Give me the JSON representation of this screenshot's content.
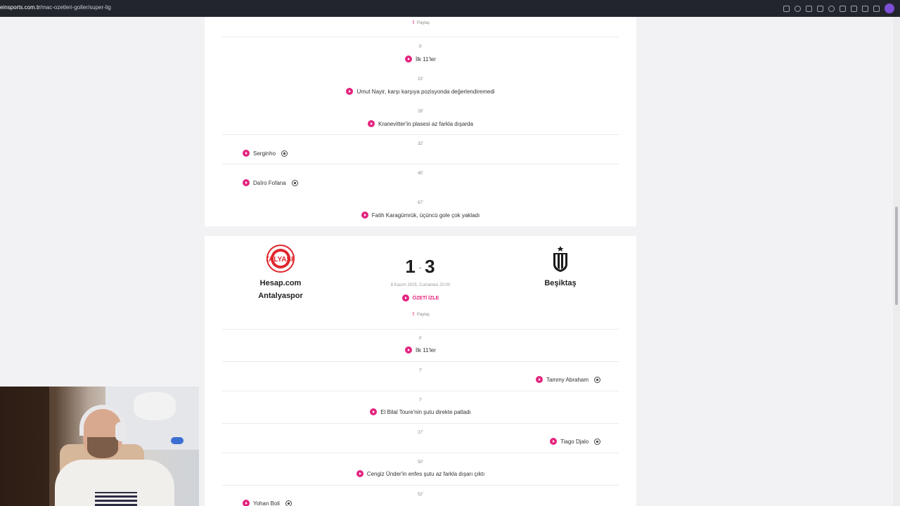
{
  "browser": {
    "url_host": "einsports.com.tr",
    "url_path": "/mac-ozetleri-goller/super-lig"
  },
  "top_card": {
    "share_label": "Paylaş",
    "events": [
      {
        "minute": "0'",
        "text": "İlk 11'ler",
        "side": "center",
        "goal": false
      },
      {
        "minute": "23'",
        "text": "Umut Nayir, karşı karşıya pozisyonda değerlendiremedi",
        "side": "center",
        "goal": false
      },
      {
        "minute": "29'",
        "text": "Kranevitter'in plasesi az farkla dışarda",
        "side": "center",
        "goal": false
      },
      {
        "minute": "32'",
        "text": "Serginho",
        "side": "left",
        "goal": true
      },
      {
        "minute": "45'",
        "text": "Daîro Fofana",
        "side": "left",
        "goal": true
      },
      {
        "minute": "67'",
        "text": "Fatih Karagümrük, üçüncü gole çok yakladı",
        "side": "center",
        "goal": false
      }
    ]
  },
  "match": {
    "home_team_line1": "Hesap.com",
    "home_team_line2": "Antalyaspor",
    "away_team": "Beşiktaş",
    "home_score": "1",
    "away_score": "3",
    "score_separator": "-",
    "date": "8 Kasım 2025, Cumartesi 20:00",
    "summary_label": "ÖZETİ İZLE",
    "share_label": "Paylaş",
    "home_logo_text": "ANTALYASPOR",
    "events": [
      {
        "minute": "0'",
        "text": "İlk 11'ler",
        "side": "center",
        "goal": false
      },
      {
        "minute": "7'",
        "text": "Tammy Abraham",
        "side": "right",
        "goal": true
      },
      {
        "minute": "7'",
        "text": "El Bilal Toure'nin şutu direkte patladı",
        "side": "center",
        "goal": false
      },
      {
        "minute": "27'",
        "text": "Tiago Djalo",
        "side": "right",
        "goal": true
      },
      {
        "minute": "50'",
        "text": "Cengiz Ünder'in enfes şutu az farkla dışarı çıktı",
        "side": "center",
        "goal": false
      },
      {
        "minute": "52'",
        "text": "Yohan Boli",
        "side": "left",
        "goal": true
      }
    ]
  },
  "colors": {
    "accent": "#e3247f",
    "antalyaspor_red": "#e0262d",
    "besiktas_black": "#1a1a1a"
  }
}
